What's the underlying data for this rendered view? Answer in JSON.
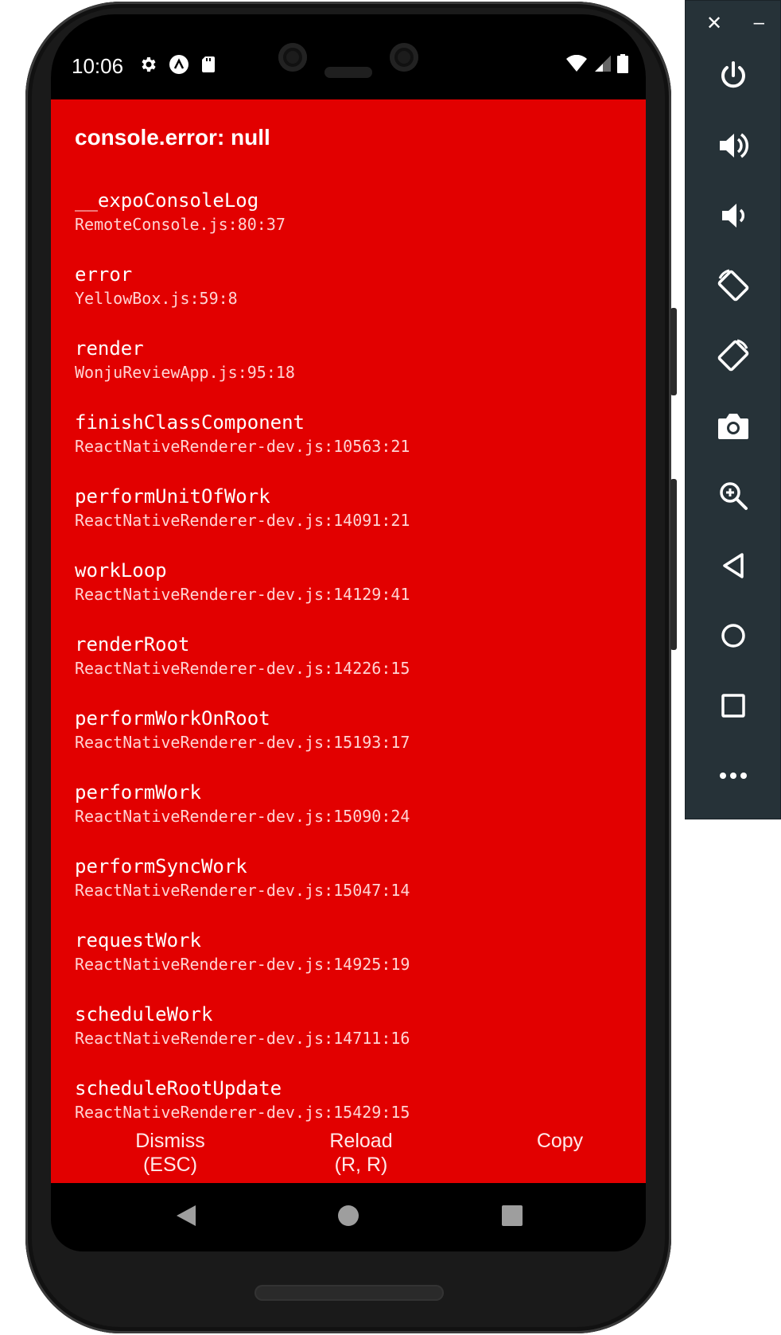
{
  "status_bar": {
    "time": "10:06"
  },
  "error": {
    "title": "console.error: null",
    "frames": [
      {
        "fn": "__expoConsoleLog",
        "loc": "RemoteConsole.js:80:37"
      },
      {
        "fn": "error",
        "loc": "YellowBox.js:59:8"
      },
      {
        "fn": "render",
        "loc": "WonjuReviewApp.js:95:18"
      },
      {
        "fn": "finishClassComponent",
        "loc": "ReactNativeRenderer-dev.js:10563:21"
      },
      {
        "fn": "performUnitOfWork",
        "loc": "ReactNativeRenderer-dev.js:14091:21"
      },
      {
        "fn": "workLoop",
        "loc": "ReactNativeRenderer-dev.js:14129:41"
      },
      {
        "fn": "renderRoot",
        "loc": "ReactNativeRenderer-dev.js:14226:15"
      },
      {
        "fn": "performWorkOnRoot",
        "loc": "ReactNativeRenderer-dev.js:15193:17"
      },
      {
        "fn": "performWork",
        "loc": "ReactNativeRenderer-dev.js:15090:24"
      },
      {
        "fn": "performSyncWork",
        "loc": "ReactNativeRenderer-dev.js:15047:14"
      },
      {
        "fn": "requestWork",
        "loc": "ReactNativeRenderer-dev.js:14925:19"
      },
      {
        "fn": "scheduleWork",
        "loc": "ReactNativeRenderer-dev.js:14711:16"
      },
      {
        "fn": "scheduleRootUpdate",
        "loc": "ReactNativeRenderer-dev.js:15429:15"
      }
    ]
  },
  "actions": {
    "dismiss_line1": "Dismiss",
    "dismiss_line2": "(ESC)",
    "reload_line1": "Reload",
    "reload_line2": "(R, R)",
    "copy": "Copy"
  },
  "colors": {
    "redbox": "#e20000",
    "toolbar": "#263238"
  },
  "toolbar": {
    "close": "✕",
    "minimize": "–",
    "buttons": [
      "power-icon",
      "volume-up-icon",
      "volume-down-icon",
      "rotate-left-icon",
      "rotate-right-icon",
      "camera-icon",
      "zoom-icon",
      "back-icon",
      "home-icon",
      "overview-icon",
      "more-icon"
    ]
  }
}
